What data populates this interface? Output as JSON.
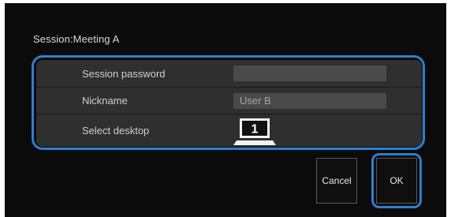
{
  "dialog": {
    "session_title": "Session:Meeting A",
    "rows": {
      "password": {
        "label": "Session password",
        "value": ""
      },
      "nickname": {
        "label": "Nickname",
        "value": "User B"
      },
      "desktop": {
        "label": "Select desktop",
        "selected": "1",
        "icon": "monitor-icon"
      }
    },
    "buttons": {
      "cancel_label": "Cancel",
      "ok_label": "OK"
    }
  },
  "colors": {
    "highlight": "#2d7fd1",
    "background": "#0b0b0b",
    "panel": "#2f2f2f",
    "field": "#4a4a4a"
  }
}
